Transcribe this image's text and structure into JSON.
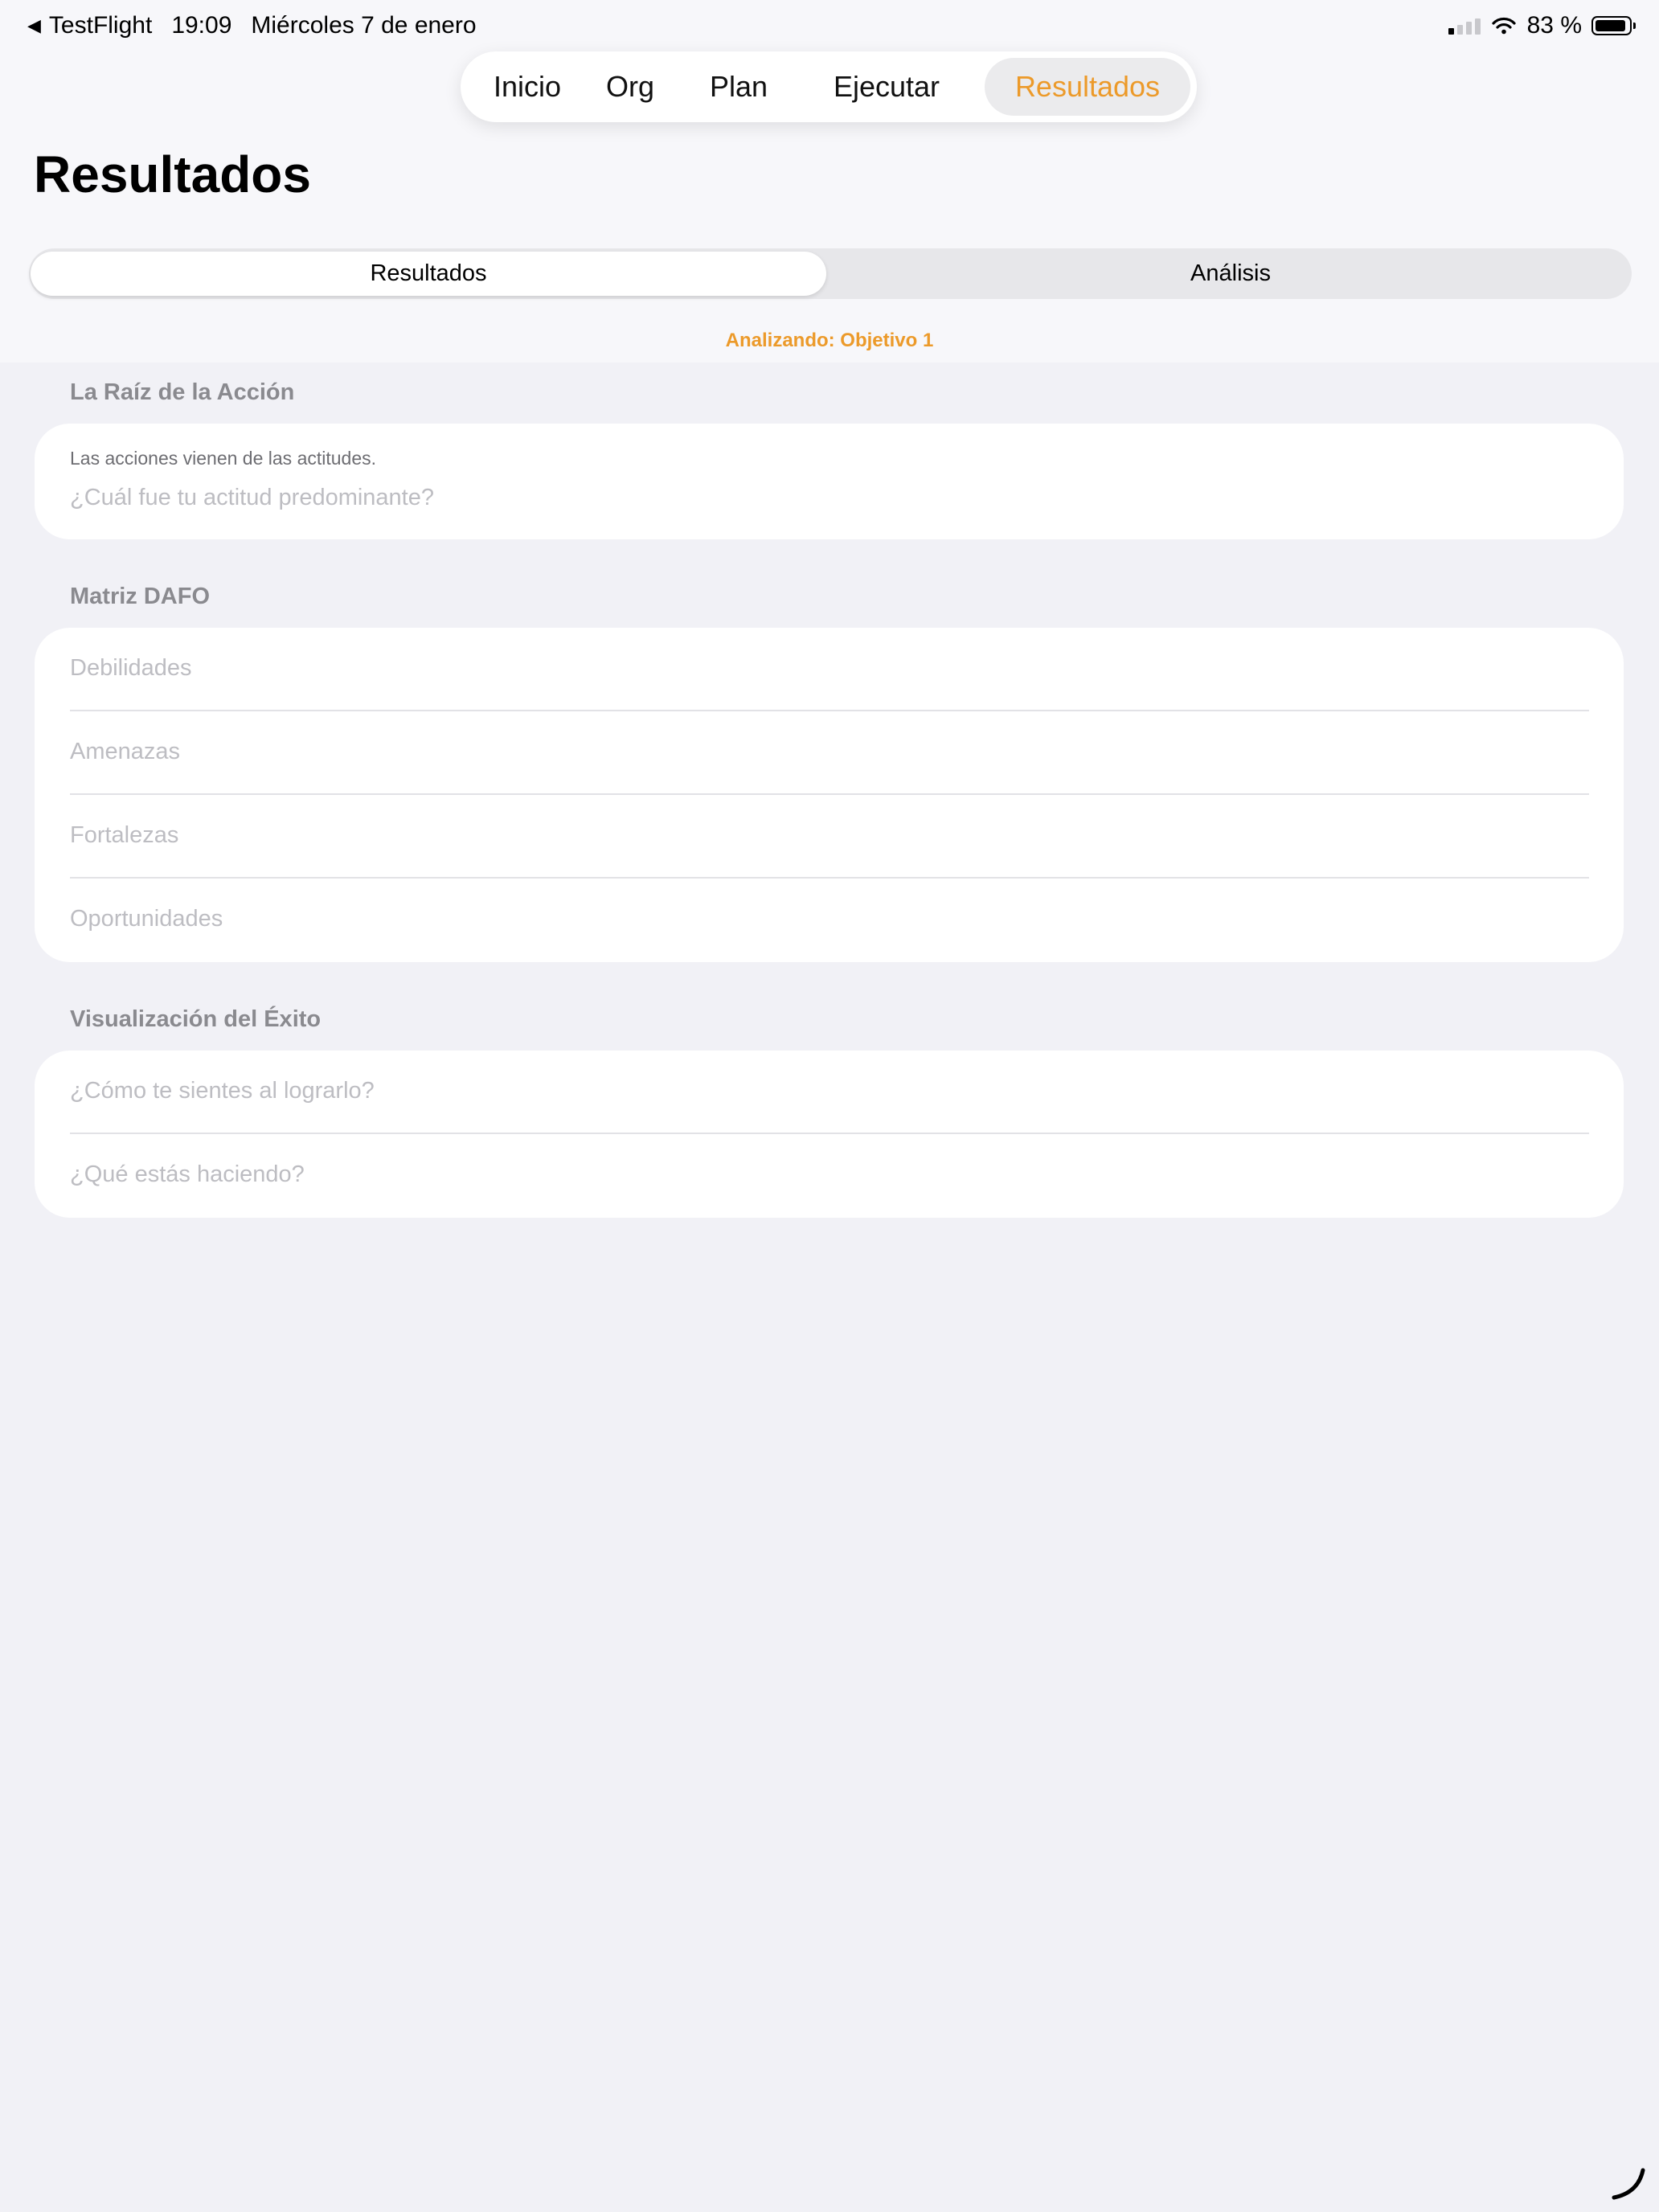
{
  "status_bar": {
    "back_app": "TestFlight",
    "time": "19:09",
    "date": "Miércoles 7 de enero",
    "battery_text": "83 %"
  },
  "top_tabs": [
    {
      "label": "Inicio"
    },
    {
      "label": "Org"
    },
    {
      "label": "Plan"
    },
    {
      "label": "Ejecutar"
    },
    {
      "label": "Resultados",
      "active": true
    }
  ],
  "page_title": "Resultados",
  "segmented": {
    "options": [
      "Resultados",
      "Análisis"
    ],
    "selected": "Resultados"
  },
  "analyzing_label": "Analizando: Objetivo 1",
  "sections": {
    "root_action": {
      "label": "La Raíz de la Acción",
      "hint": "Las acciones vienen de las actitudes.",
      "placeholder": "¿Cuál fue tu actitud predominante?"
    },
    "dafo": {
      "label": "Matriz DAFO",
      "fields": [
        "Debilidades",
        "Amenazas",
        "Fortalezas",
        "Oportunidades"
      ]
    },
    "success": {
      "label": "Visualización del Éxito",
      "fields": [
        "¿Cómo te sientes al lograrlo?",
        "¿Qué estás haciendo?"
      ]
    }
  },
  "colors": {
    "accent": "#ec9a2a",
    "background": "#f1f1f6",
    "card": "#ffffff",
    "section_label": "#8a8a8f",
    "placeholder": "#bdbdc2"
  }
}
